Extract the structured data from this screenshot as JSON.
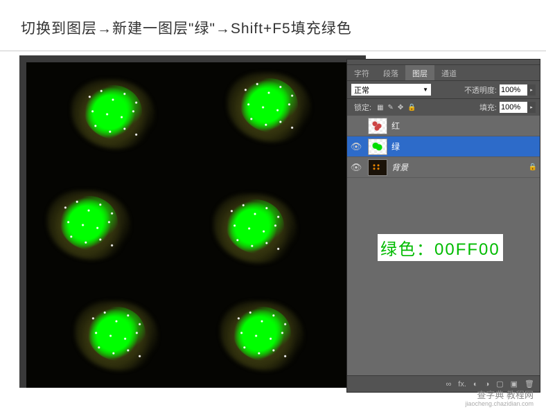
{
  "instruction": "切换到图层→新建一图层\"绿\"→Shift+F5填充绿色",
  "panel": {
    "tabs": [
      "字符",
      "段落",
      "图层",
      "通道"
    ],
    "active_tab_index": 2,
    "blend_mode": "正常",
    "opacity_label": "不透明度:",
    "opacity_value": "100%",
    "lock_label": "锁定:",
    "fill_label": "填充:",
    "fill_value": "100%",
    "layers": [
      {
        "visible": false,
        "name": "红",
        "selected": false,
        "locked": false,
        "thumb": "red"
      },
      {
        "visible": true,
        "name": "绿",
        "selected": true,
        "locked": false,
        "thumb": "green"
      },
      {
        "visible": true,
        "name": "背景",
        "selected": false,
        "locked": true,
        "thumb": "bg"
      }
    ],
    "footer_icons": [
      "∞",
      "fx.",
      "◐",
      "◑",
      "▢",
      "▣",
      "🗑"
    ]
  },
  "color_note": "绿色：00FF00",
  "watermark": {
    "main": "查字典 教程网",
    "sub": "jiaocheng.chazidian.com"
  }
}
